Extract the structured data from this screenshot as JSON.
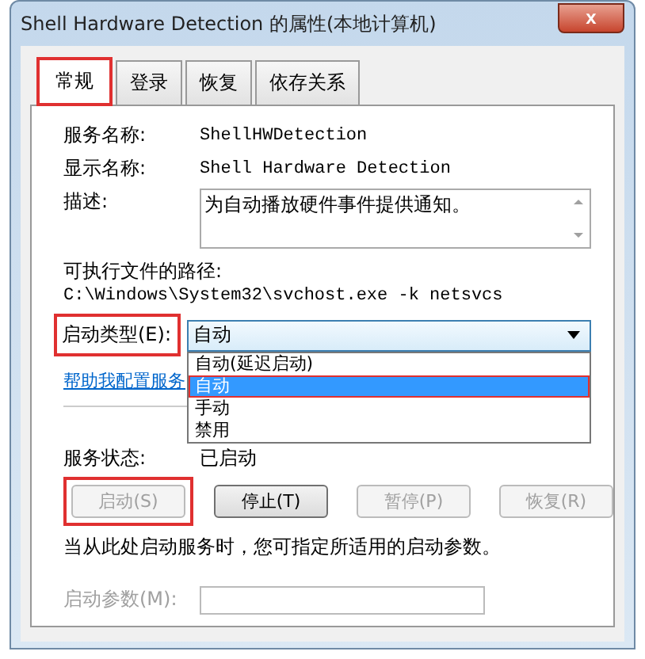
{
  "window": {
    "title": "Shell Hardware Detection 的属性(本地计算机)",
    "close": "x"
  },
  "tabs": [
    {
      "label": "常规",
      "selected": true,
      "annotated": true
    },
    {
      "label": "登录",
      "selected": false,
      "annotated": false
    },
    {
      "label": "恢复",
      "selected": false,
      "annotated": false
    },
    {
      "label": "依存关系",
      "selected": false,
      "annotated": false
    }
  ],
  "service_name": {
    "label": "服务名称:",
    "value": "ShellHWDetection"
  },
  "display_name": {
    "label": "显示名称:",
    "value": "Shell Hardware Detection"
  },
  "description": {
    "label": "描述:",
    "value": "为自动播放硬件事件提供通知。"
  },
  "executable_path": {
    "label": "可执行文件的路径:",
    "value": "C:\\Windows\\System32\\svchost.exe -k netsvcs"
  },
  "startup_type": {
    "label": "启动类型(E):",
    "annotated": true,
    "value": "自动",
    "expanded": true,
    "options": [
      {
        "label": "自动(延迟启动)",
        "selected": false,
        "annotated": false
      },
      {
        "label": "自动",
        "selected": true,
        "annotated": true
      },
      {
        "label": "手动",
        "selected": false,
        "annotated": false
      },
      {
        "label": "禁用",
        "selected": false,
        "annotated": false
      }
    ]
  },
  "help_link": "帮助我配置服务",
  "service_status": {
    "label": "服务状态:",
    "value": "已启动"
  },
  "service_buttons": [
    {
      "label": "启动(S)",
      "disabled": true,
      "annotated": true
    },
    {
      "label": "停止(T)",
      "disabled": false,
      "annotated": false
    },
    {
      "label": "暂停(P)",
      "disabled": true,
      "annotated": false
    },
    {
      "label": "恢复(R)",
      "disabled": true,
      "annotated": false
    }
  ],
  "hint": "当从此处启动服务时，您可指定所适用的启动参数。",
  "start_parameters": {
    "label": "启动参数(M):",
    "disabled": true
  }
}
